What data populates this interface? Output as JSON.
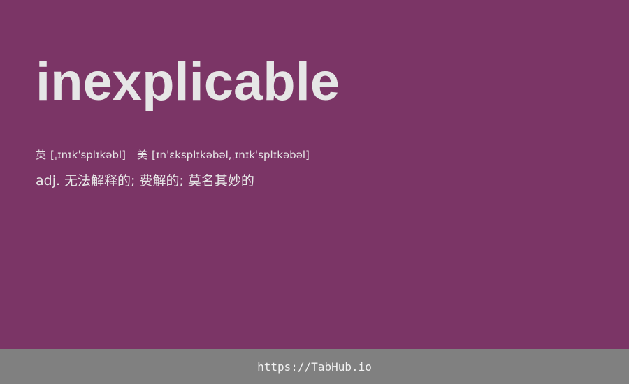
{
  "word": "inexplicable",
  "phonetics": {
    "uk_label": "英",
    "uk": "[ˌɪnɪkˈsplɪkəbl]",
    "us_label": "美",
    "us": "[ɪnˈɛksplɪkəbəl,ˌɪnɪkˈsplɪkəbəl]"
  },
  "definition": {
    "pos": "adj.",
    "meaning": "无法解释的; 费解的; 莫名其妙的"
  },
  "footer": {
    "link": "https://TabHub.io"
  },
  "colors": {
    "background": "#7b3566",
    "footer": "#808080",
    "text": "#e6e6e6"
  }
}
